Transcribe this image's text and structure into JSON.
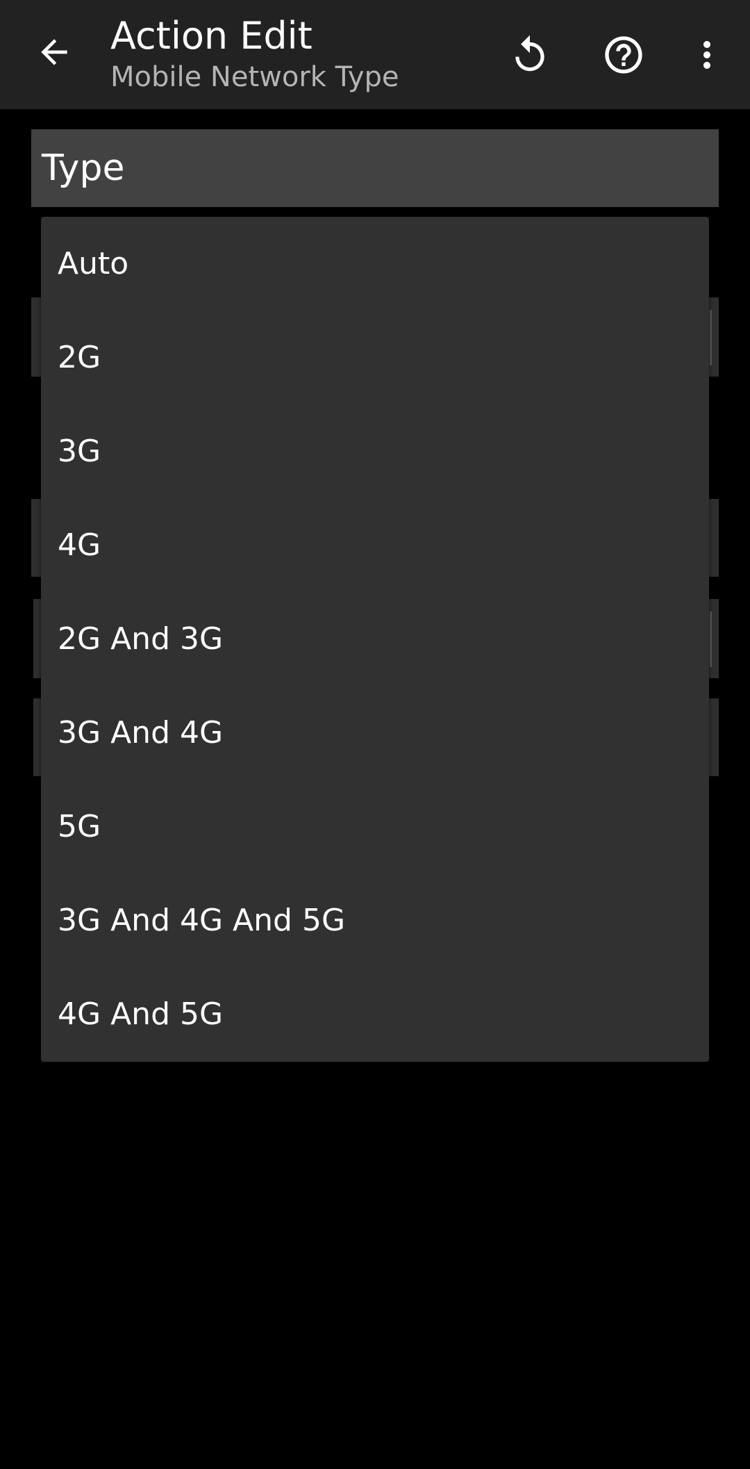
{
  "appbar": {
    "title": "Action Edit",
    "subtitle": "Mobile Network Type",
    "icons": [
      "back-arrow-icon",
      "reset-icon",
      "help-icon",
      "more-vert-icon"
    ]
  },
  "section": {
    "label": "Type"
  },
  "dropdown": {
    "options": [
      "Auto",
      "2G",
      "3G",
      "4G",
      "2G And 3G",
      "3G And 4G",
      "5G",
      "3G And 4G And 5G",
      "4G And 5G"
    ]
  },
  "colors": {
    "background": "#000000",
    "appbar": "#222222",
    "section_header": "#424242",
    "dropdown": "#313131",
    "subtitle": "#b4b4b4"
  }
}
